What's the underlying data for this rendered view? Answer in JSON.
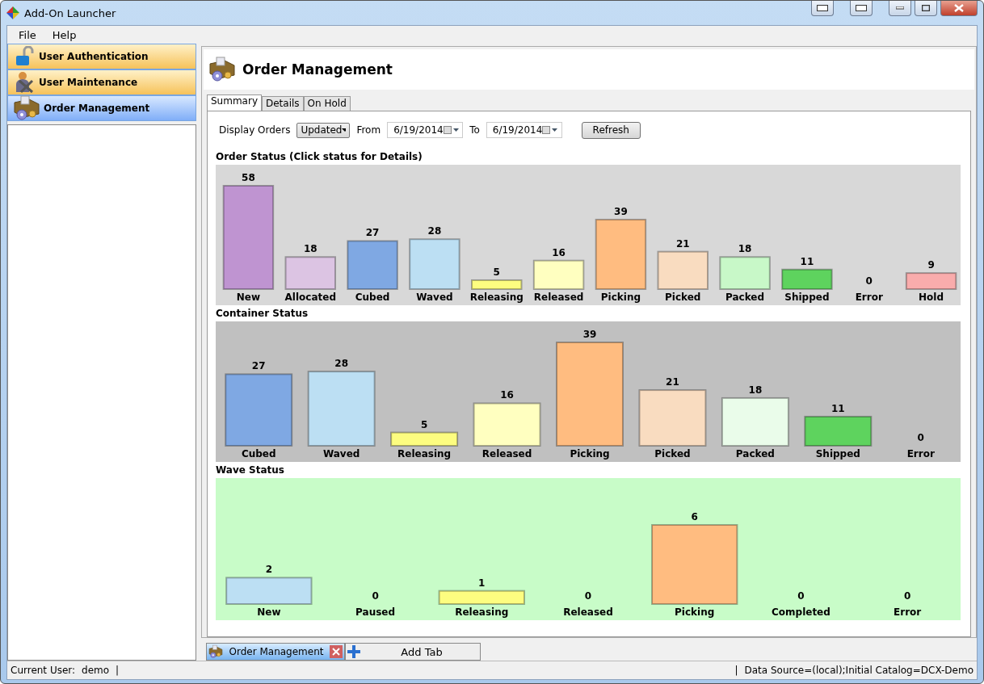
{
  "window": {
    "title": "Add-On Launcher"
  },
  "menu": [
    "File",
    "Help"
  ],
  "sidebar": {
    "items": [
      {
        "label": "User Authentication",
        "selected": false
      },
      {
        "label": "User Maintenance",
        "selected": false
      },
      {
        "label": "Order Management",
        "selected": true
      }
    ]
  },
  "header": {
    "title": "Order Management"
  },
  "tabs": [
    {
      "label": "Summary",
      "selected": true
    },
    {
      "label": "Details",
      "selected": false
    },
    {
      "label": "On Hold",
      "selected": false
    }
  ],
  "filters": {
    "display_label": "Display Orders",
    "display_value": "Updated",
    "from_label": "From",
    "from_date": "6/19/2014",
    "to_label": "To",
    "to_date": "6/19/2014",
    "refresh": "Refresh"
  },
  "sections": [
    {
      "title": "Order Status (Click status for Details)",
      "chart_data": {
        "type": "bar",
        "categories": [
          "New",
          "Allocated",
          "Cubed",
          "Waved",
          "Releasing",
          "Released",
          "Picking",
          "Picked",
          "Packed",
          "Shipped",
          "Error",
          "Hold"
        ],
        "data_labels": true,
        "series": [
          {
            "values": [
              58,
              18,
              27,
              28,
              5,
              16,
              39,
              21,
              18,
              11,
              0,
              9
            ],
            "colors": [
              "#bf94d1",
              "#dcc4e3",
              "#7fa8e3",
              "#bcdff3",
              "#fdfd80",
              "#ffffc0",
              "#ffbc80",
              "#f9dcc0",
              "#c8f8c8",
              "#5ed35e",
              "#d0d0d0",
              "#f9acac"
            ]
          }
        ]
      }
    },
    {
      "title": "Container Status",
      "chart_data": {
        "type": "bar",
        "categories": [
          "Cubed",
          "Waved",
          "Releasing",
          "Released",
          "Picking",
          "Picked",
          "Packed",
          "Shipped",
          "Error"
        ],
        "data_labels": true,
        "series": [
          {
            "values": [
              27,
              28,
              5,
              16,
              39,
              21,
              18,
              11,
              0
            ],
            "colors": [
              "#7fa8e3",
              "#bcdff3",
              "#fdfd80",
              "#ffffc0",
              "#ffbc80",
              "#f9dcc0",
              "#eafcea",
              "#5ed35e",
              "#d0d0d0"
            ]
          }
        ]
      }
    },
    {
      "title": "Wave Status",
      "chart_data": {
        "type": "bar",
        "categories": [
          "New",
          "Paused",
          "Releasing",
          "Released",
          "Picking",
          "Completed",
          "Error"
        ],
        "data_labels": true,
        "series": [
          {
            "values": [
              2,
              0,
              1,
              0,
              6,
              0,
              0
            ],
            "colors": [
              "#bcdff3",
              "#d0d0d0",
              "#fdfd80",
              "#ffffc0",
              "#ffbc80",
              "#d0d0d0",
              "#d0d0d0"
            ]
          }
        ]
      }
    }
  ],
  "doc_tabs": [
    {
      "label": "Order Management",
      "selected": true,
      "kind": "closable"
    },
    {
      "label": "Add Tab",
      "selected": false,
      "kind": "add"
    }
  ],
  "status_bar": {
    "user_label": "Current User:",
    "user": "demo",
    "left_separator": "|",
    "right_separator": "|",
    "data_source": "Data Source=(local);Initial Catalog=DCX-Demo"
  }
}
